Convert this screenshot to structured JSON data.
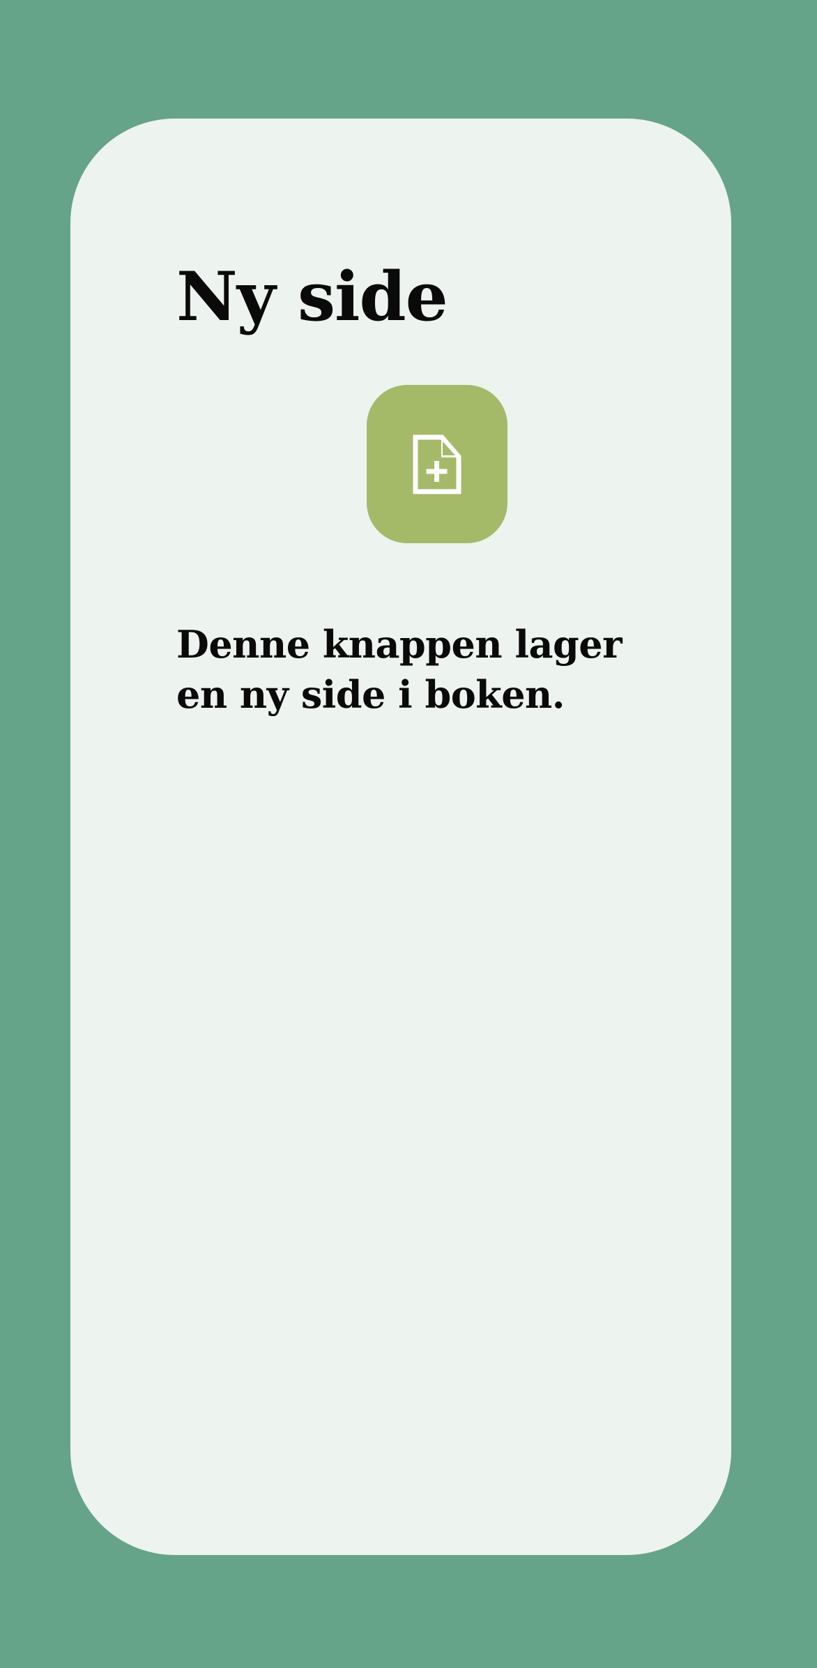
{
  "page": {
    "title": "Ny side",
    "description": "Denne knappen lager en ny side i boken."
  },
  "button": {
    "icon": "new-page-icon",
    "color": "#a4ba69"
  },
  "colors": {
    "background": "#65a488",
    "card": "#edf3ef",
    "text": "#0a0a0a"
  }
}
